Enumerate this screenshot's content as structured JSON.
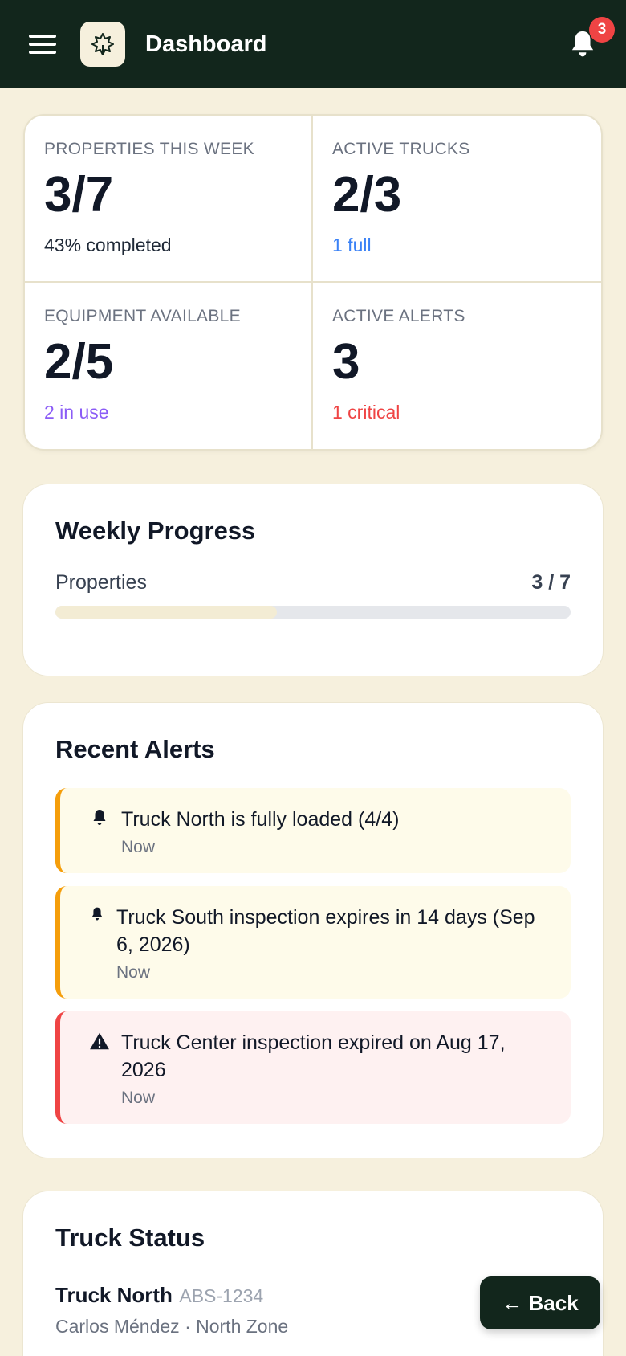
{
  "header": {
    "title": "Dashboard",
    "notification_count": "3"
  },
  "stats": [
    {
      "label": "Properties this week",
      "value": "3/7",
      "sub": "43% completed",
      "sub_color": "#1f2937"
    },
    {
      "label": "Active Trucks",
      "value": "2/3",
      "sub": "1 full",
      "sub_color": "#3b82f6"
    },
    {
      "label": "Equipment Available",
      "value": "2/5",
      "sub": "2 in use",
      "sub_color": "#8b5cf6"
    },
    {
      "label": "Active Alerts",
      "value": "3",
      "sub": "1 critical",
      "sub_color": "#ef4444"
    }
  ],
  "weekly_progress": {
    "title": "Weekly Progress",
    "label": "Properties",
    "count": "3 / 7",
    "fraction": 0.43
  },
  "recent_alerts": {
    "title": "Recent Alerts",
    "items": [
      {
        "text": "Truck North is fully loaded (4/4)",
        "time": "Now",
        "icon": "bell-icon",
        "severity": "warning"
      },
      {
        "text": "Truck South inspection expires in 14 days (Sep 6, 2026)",
        "time": "Now",
        "icon": "bell-icon",
        "severity": "warning"
      },
      {
        "text": "Truck Center inspection expired on Aug 17, 2026",
        "time": "Now",
        "icon": "warning-triangle-icon",
        "severity": "critical"
      }
    ]
  },
  "truck_status": {
    "title": "Truck Status",
    "trucks": [
      {
        "name": "Truck North",
        "plate": "ABS-1234",
        "meta": "Carlos Méndez · North Zone"
      }
    ]
  },
  "back_button": "← Back",
  "colors": {
    "header_bg": "#12261c",
    "page_bg": "#f6f0dd",
    "warning_border": "#f59e0b",
    "warning_bg": "#fefbea",
    "critical_border": "#ef4444",
    "critical_bg": "#fef1f1"
  }
}
